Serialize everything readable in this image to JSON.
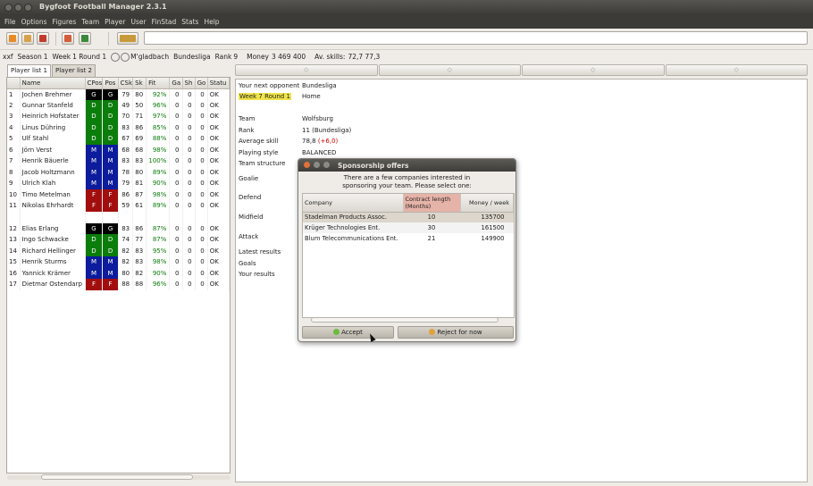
{
  "window": {
    "title": "Bygfoot Football Manager 2.3.1"
  },
  "menu": [
    "File",
    "Options",
    "Figures",
    "Team",
    "Player",
    "User",
    "FinStad",
    "Stats",
    "Help"
  ],
  "toolbar": {
    "icons": [
      "open-icon",
      "save-icon",
      "quit-icon",
      "home-icon",
      "transfer-icon",
      "new-week-icon"
    ]
  },
  "info": {
    "user": "xxf",
    "season_label": "Season",
    "season": "1",
    "week_label": "Week",
    "week": "1 Round 1",
    "team": "M'gladbach",
    "league": "Bundesliga",
    "rank_label": "Rank",
    "rank": "9",
    "money_label": "Money",
    "money": "3 469 400",
    "avskills_label": "Av. skills:",
    "avskills": "72,7  77,3"
  },
  "tabs": [
    "Player list 1",
    "Player list 2"
  ],
  "player_table": {
    "columns": [
      "",
      "Name",
      "CPos",
      "Pos",
      "CSk",
      "Sk",
      "Fit",
      "Ga",
      "Sh",
      "Go",
      "Statu"
    ],
    "rows": [
      [
        "1",
        "Jochen Brehmer",
        "G",
        "G",
        "79",
        "80",
        "92%",
        "0",
        "0",
        "0",
        "OK"
      ],
      [
        "2",
        "Gunnar Stanfeld",
        "D",
        "D",
        "49",
        "50",
        "96%",
        "0",
        "0",
        "0",
        "OK"
      ],
      [
        "3",
        "Heinrich Hofstater",
        "D",
        "D",
        "70",
        "71",
        "97%",
        "0",
        "0",
        "0",
        "OK"
      ],
      [
        "4",
        "Linus Dühring",
        "D",
        "D",
        "83",
        "86",
        "85%",
        "0",
        "0",
        "0",
        "OK"
      ],
      [
        "5",
        "Ulf Stahl",
        "D",
        "D",
        "67",
        "69",
        "88%",
        "0",
        "0",
        "0",
        "OK"
      ],
      [
        "6",
        "Jörn Verst",
        "M",
        "M",
        "68",
        "68",
        "98%",
        "0",
        "0",
        "0",
        "OK"
      ],
      [
        "7",
        "Henrik Bäuerle",
        "M",
        "M",
        "83",
        "83",
        "100%",
        "0",
        "0",
        "0",
        "OK"
      ],
      [
        "8",
        "Jacob Holtzmann",
        "M",
        "M",
        "78",
        "80",
        "89%",
        "0",
        "0",
        "0",
        "OK"
      ],
      [
        "9",
        "Ulrich Klah",
        "M",
        "M",
        "79",
        "81",
        "90%",
        "0",
        "0",
        "0",
        "OK"
      ],
      [
        "10",
        "Timo Metelman",
        "F",
        "F",
        "86",
        "87",
        "98%",
        "0",
        "0",
        "0",
        "OK"
      ],
      [
        "11",
        "Nikolas Ehrhardt",
        "F",
        "F",
        "59",
        "61",
        "89%",
        "0",
        "0",
        "0",
        "OK"
      ],
      [
        "",
        "",
        "",
        "",
        "",
        "",
        "",
        "",
        "",
        "",
        ""
      ],
      [
        "12",
        "Elias Erlang",
        "G",
        "G",
        "83",
        "86",
        "87%",
        "0",
        "0",
        "0",
        "OK"
      ],
      [
        "13",
        "Ingo Schwacke",
        "D",
        "D",
        "74",
        "77",
        "87%",
        "0",
        "0",
        "0",
        "OK"
      ],
      [
        "14",
        "Richard Hellinger",
        "D",
        "D",
        "82",
        "83",
        "95%",
        "0",
        "0",
        "0",
        "OK"
      ],
      [
        "15",
        "Henrik Sturms",
        "M",
        "M",
        "82",
        "83",
        "98%",
        "0",
        "0",
        "0",
        "OK"
      ],
      [
        "16",
        "Yannick Krämer",
        "M",
        "M",
        "80",
        "82",
        "90%",
        "0",
        "0",
        "0",
        "OK"
      ],
      [
        "17",
        "Dietmar Ostendarp",
        "F",
        "F",
        "88",
        "88",
        "96%",
        "0",
        "0",
        "0",
        "OK"
      ]
    ]
  },
  "opponent": {
    "next_label": "Your next opponent",
    "next_value": "Bundesliga",
    "week_value": "Week 7 Round 1",
    "venue": "Home",
    "team_label": "Team",
    "team_value": "Wolfsburg",
    "rank_label": "Rank",
    "rank_value": "11 (Bundesliga)",
    "avg_label": "Average skill",
    "avg_value": "78,8",
    "avg_diff": "(+6,0)",
    "style_label": "Playing style",
    "style_value": "BALANCED",
    "structure_label": "Team structure",
    "goalie_label": "Goalie",
    "defend_label": "Defend",
    "midfield_label": "Midfield",
    "attack_label": "Attack",
    "latest_label": "Latest results",
    "goals_label": "Goals",
    "yours_label": "Your results"
  },
  "dialog": {
    "title": "Sponsorship offers",
    "message_1": "There are a few companies interested in",
    "message_2": "sponsoring your team. Please select one:",
    "columns": [
      "Company",
      "Contract length (Months)",
      "Money / week"
    ],
    "rows": [
      [
        "Stadelman Products Assoc.",
        "10",
        "135700"
      ],
      [
        "Krüger Technologies Ent.",
        "30",
        "161500"
      ],
      [
        "Blum Telecommunications Ent.",
        "21",
        "149900"
      ]
    ],
    "accept": "Accept",
    "reject": "Reject for now"
  },
  "colors": {
    "goalkeeper": "#000000",
    "defender": "#0b7d0b",
    "midfielder": "#0c1c9c",
    "forward": "#a20e0e",
    "fit_text": "#0a7a0a"
  }
}
